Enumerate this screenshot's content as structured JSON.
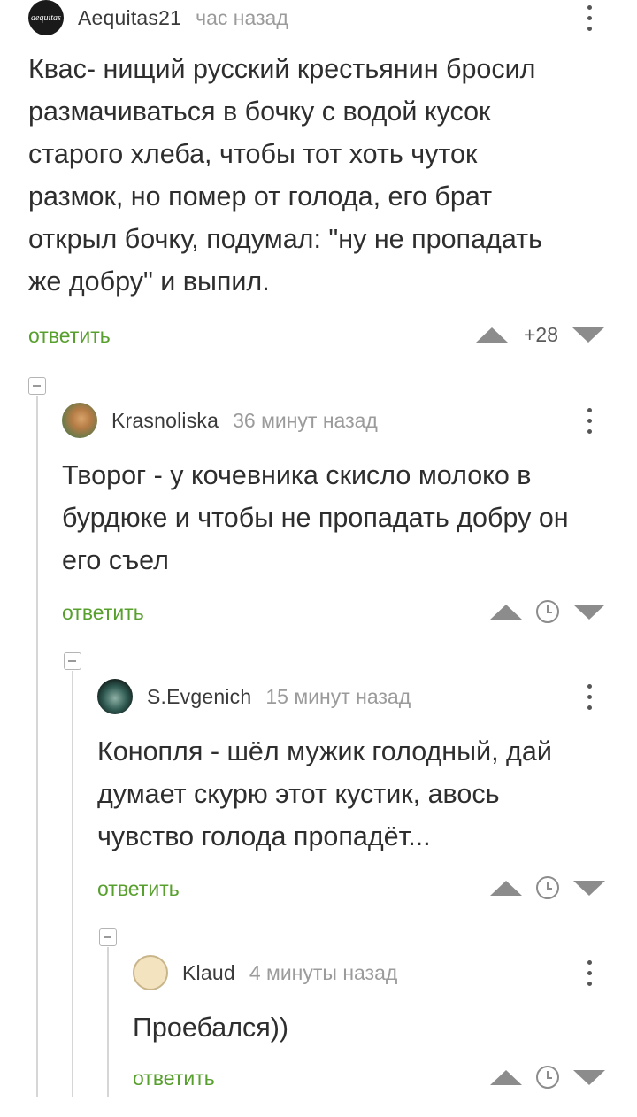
{
  "comments": [
    {
      "author": "Aequitas21",
      "avatar_text": "aequitas",
      "time": "час назад",
      "lines": [
        "Квас- нищий русский крестьянин бросил",
        "размачиваться в бочку с водой кусок",
        "старого хлеба, чтобы тот хоть чуток",
        "размок, но помер от голода, его брат",
        "открыл бочку, подумал: \"ну не пропадать",
        "же добру\" и выпил."
      ],
      "reply_label": "ответить",
      "score": "+28"
    },
    {
      "author": "Krasnoliska",
      "time": "36 минут назад",
      "lines": [
        "Творог - у кочевника скисло молоко в",
        "бурдюке и чтобы не пропадать добру он",
        "его съел"
      ],
      "reply_label": "ответить"
    },
    {
      "author": "S.Evgenich",
      "time": "15 минут назад",
      "lines": [
        "Конопля - шёл мужик голодный, дай",
        "думает скурю этот кустик, авось",
        "чувство голода пропадёт..."
      ],
      "reply_label": "ответить"
    },
    {
      "author": "Klaud",
      "time": "4 минуты назад",
      "lines": [
        "Проебался))"
      ],
      "reply_label": "ответить"
    }
  ],
  "colors": {
    "reply_green": "#58a02e",
    "vote_gray": "#8c8c8c",
    "thread_line": "#d6d6d6"
  },
  "icons": [
    "more-vertical-icon",
    "upvote-icon",
    "downvote-icon",
    "clock-icon",
    "collapse-icon"
  ]
}
